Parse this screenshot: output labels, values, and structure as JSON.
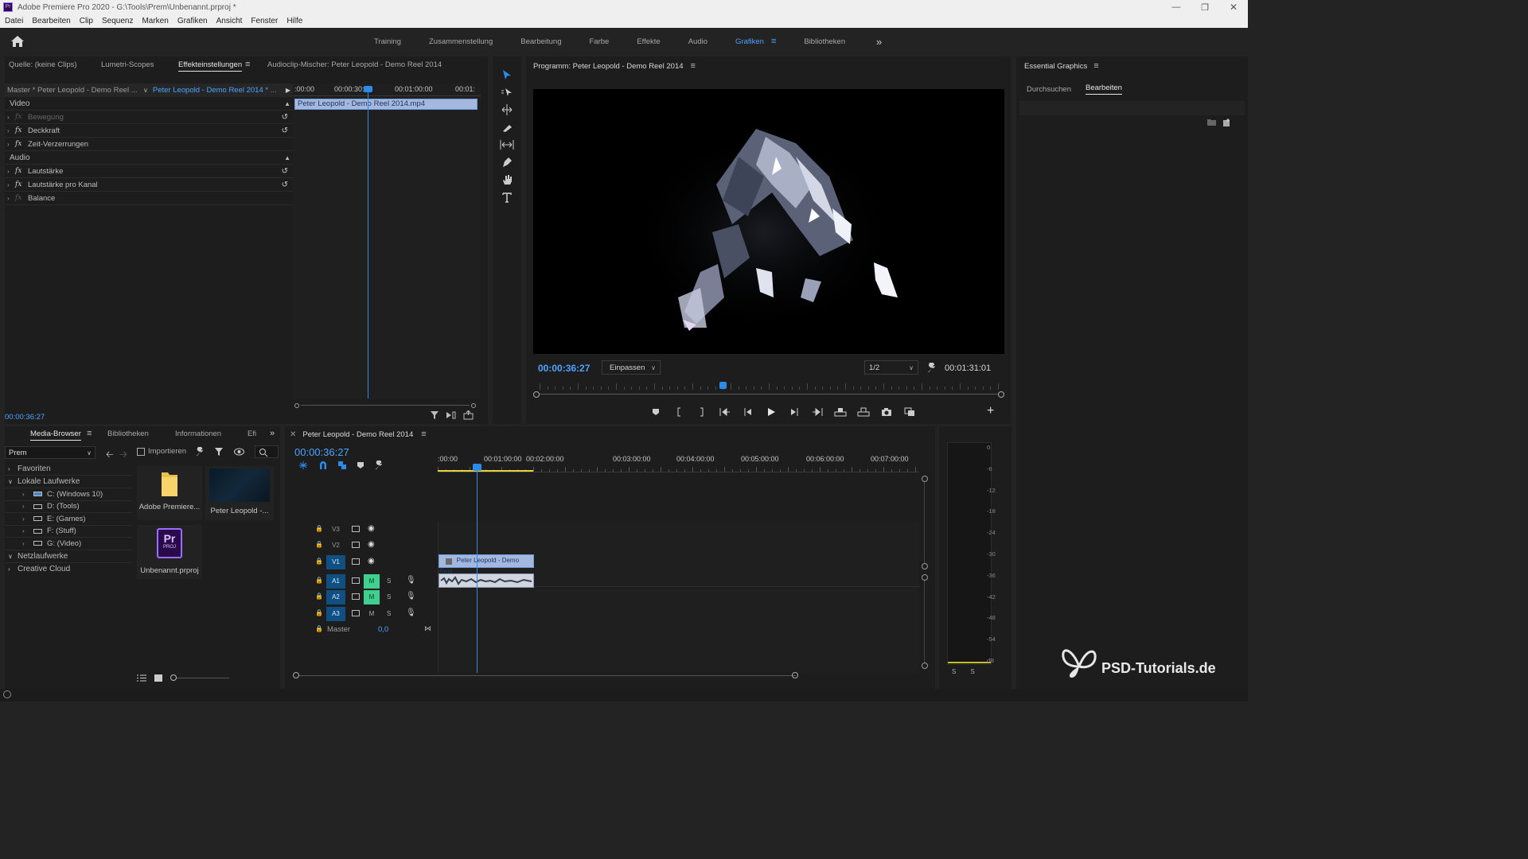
{
  "window": {
    "title": "Adobe Premiere Pro 2020 - G:\\Tools\\Prem\\Unbenannt.prproj *",
    "controls": [
      "minimize",
      "restore",
      "close"
    ]
  },
  "menu": [
    "Datei",
    "Bearbeiten",
    "Clip",
    "Sequenz",
    "Marken",
    "Grafiken",
    "Ansicht",
    "Fenster",
    "Hilfe"
  ],
  "workspaces": {
    "items": [
      "Training",
      "Zusammenstellung",
      "Bearbeitung",
      "Farbe",
      "Effekte",
      "Audio",
      "Grafiken",
      "Bibliotheken"
    ],
    "active": "Grafiken"
  },
  "source_panel": {
    "tabs": [
      "Quelle: (keine Clips)",
      "Lumetri-Scopes",
      "Effekteinstellungen",
      "Audioclip-Mischer: Peter Leopold - Demo Reel 2014"
    ],
    "active_tab": "Effekteinstellungen",
    "master_label": "Master * Peter Leopold - Demo Reel ...",
    "sequence_label": "Peter Leopold - Demo Reel 2014 * ...",
    "video_header": "Video",
    "audio_header": "Audio",
    "video_effects": [
      "Bewegung",
      "Deckkraft",
      "Zeit-Verzerrungen"
    ],
    "audio_effects": [
      "Lautstärke",
      "Lautstärke pro Kanal",
      "Balance"
    ],
    "ruler": [
      ":00:00",
      "00:00:30:00",
      "00:01:00:00",
      "00:01:"
    ],
    "clip_name": "Peter Leopold - Demo Reel 2014.mp4",
    "timecode": "00:00:36:27"
  },
  "program_monitor": {
    "title": "Programm: Peter Leopold - Demo Reel 2014",
    "timecode": "00:00:36:27",
    "fit": "Einpassen",
    "resolution": "1/2",
    "duration": "00:01:31:01",
    "playhead_fraction": 0.4
  },
  "essential_graphics": {
    "title": "Essential Graphics",
    "tabs": [
      "Durchsuchen",
      "Bearbeiten"
    ],
    "active_tab": "Bearbeiten"
  },
  "media_browser": {
    "tabs": [
      "Media-Browser",
      "Bibliotheken",
      "Informationen",
      "Efi"
    ],
    "active_tab": "Media-Browser",
    "location": "Prem",
    "import_label": "Importieren",
    "tree": {
      "favorites": "Favoriten",
      "local": "Lokale Laufwerke",
      "drives": [
        "C: (Windows 10)",
        "D: (Tools)",
        "E: (Games)",
        "F: (Stuff)",
        "G: (Video)"
      ],
      "network": "Netzlaufwerke",
      "cloud": "Creative Cloud"
    },
    "thumbs": [
      "Adobe Premiere...",
      "Peter Leopold -...",
      "Unbenannt.prproj"
    ],
    "proj_icon": {
      "top": "Pr",
      "bottom": "PROJ"
    }
  },
  "timeline": {
    "tab": "Peter Leopold - Demo Reel 2014",
    "timecode": "00:00:36:27",
    "ruler": [
      ":00:00",
      "00:01:00:00",
      "00:02:00:00",
      "00:03:00:00",
      "00:04:00:00",
      "00:05:00:00",
      "00:06:00:00",
      "00:07:00:00"
    ],
    "video_tracks": [
      "V3",
      "V2",
      "V1"
    ],
    "audio_tracks": [
      "A1",
      "A2",
      "A3"
    ],
    "mute": "M",
    "solo": "S",
    "master_label": "Master",
    "master_value": "0,0",
    "clip_label": "Peter Leopold - Demo Reel"
  },
  "audio_meter": {
    "scale": [
      "0",
      "-6",
      "-12",
      "-18",
      "-24",
      "-30",
      "-36",
      "-42",
      "-48",
      "-54",
      "dB"
    ],
    "solo_buttons": [
      "S",
      "S"
    ]
  },
  "watermark": "PSD-Tutorials.de",
  "colors": {
    "accent": "#2d8ceb",
    "clip_video": "#a4b8df",
    "clip_effect": "#6e9ad9",
    "mute_active": "#3fcf8e",
    "track_active": "#0f4f82"
  }
}
